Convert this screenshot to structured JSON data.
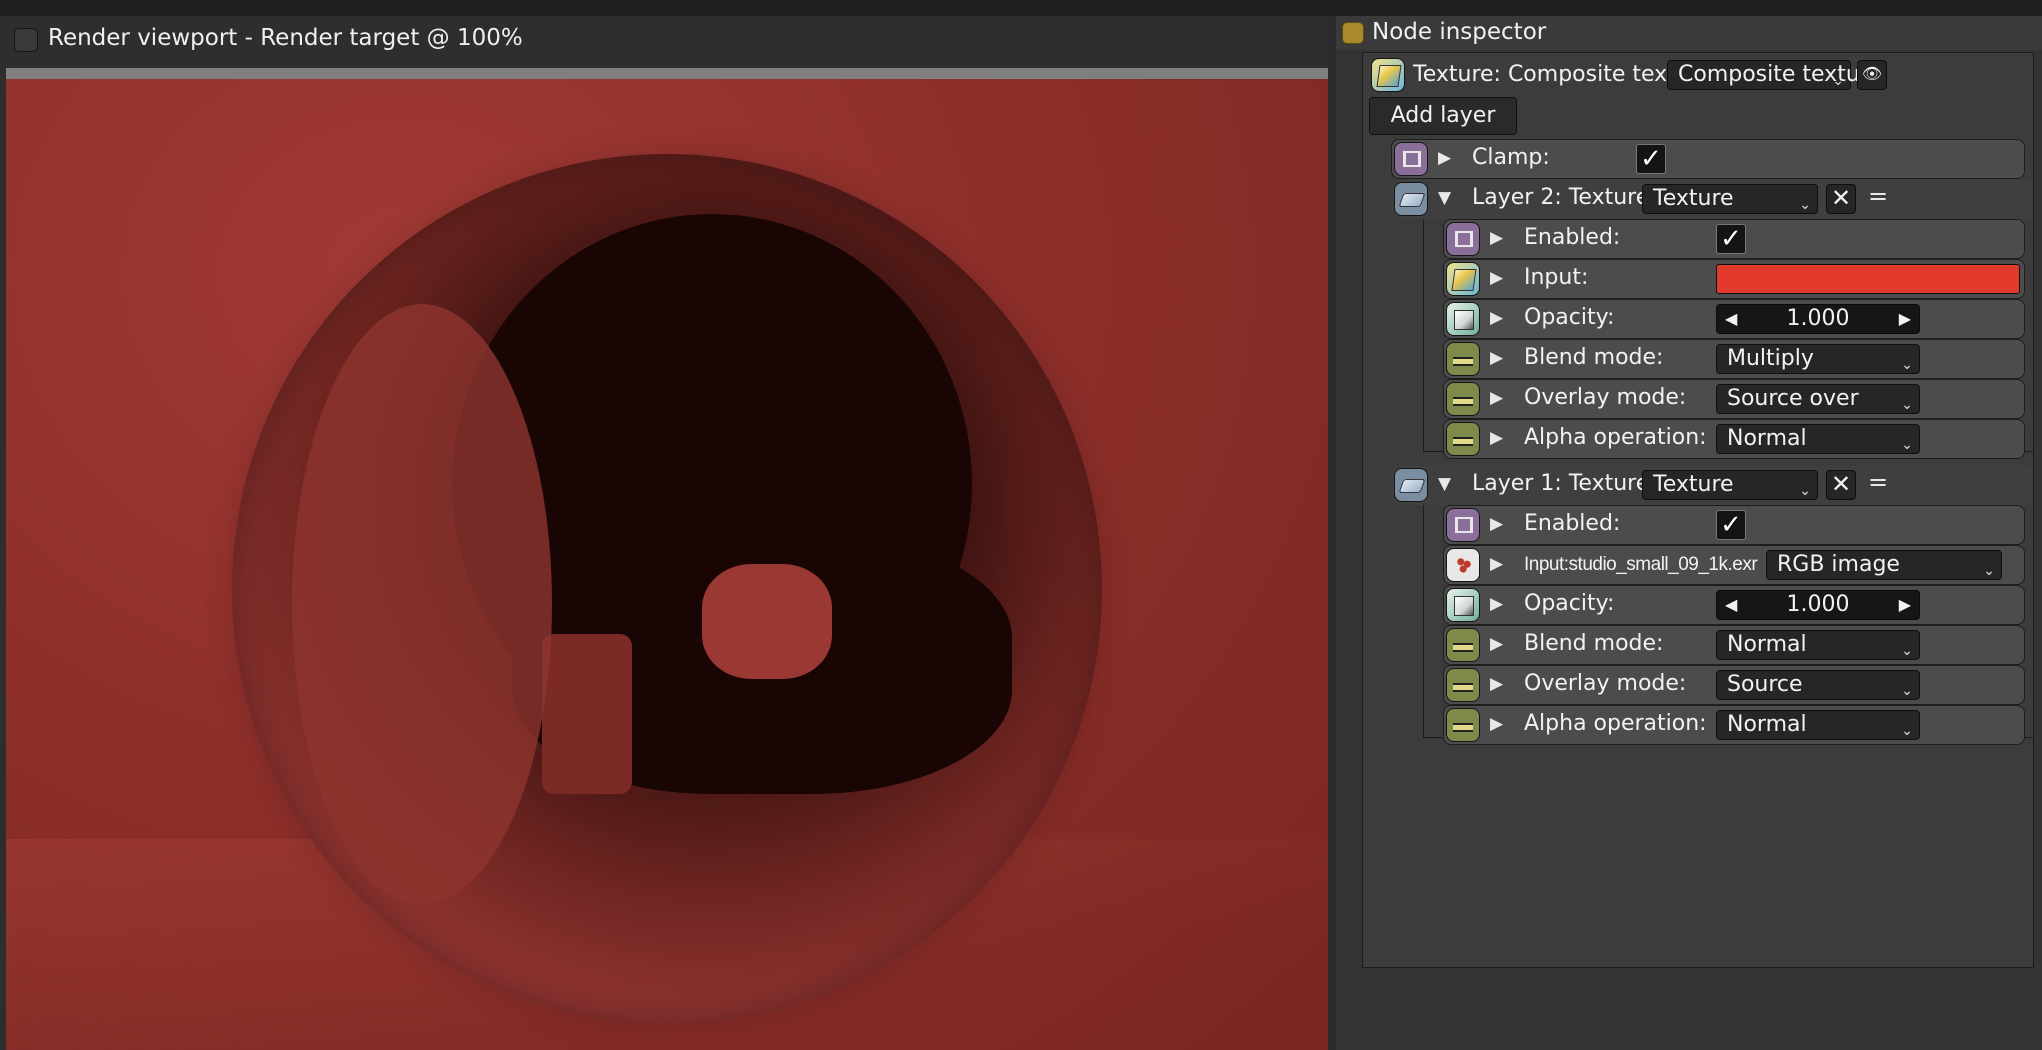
{
  "viewport": {
    "title": "Render viewport - Render target @ 100%"
  },
  "inspector": {
    "title": "Node inspector",
    "node": {
      "label": "Texture: Composite texture",
      "type_value": "Composite texture"
    },
    "add_layer_label": "Add layer",
    "clamp": {
      "label": "Clamp:",
      "checked": true
    },
    "layers": [
      {
        "title": "Layer 2: Texture",
        "type_value": "Texture",
        "rows": {
          "enabled_label": "Enabled:",
          "input_label": "Input:",
          "input_color": "#e23a2a",
          "opacity_label": "Opacity:",
          "opacity_value": "1.000",
          "blend_label": "Blend mode:",
          "blend_value": "Multiply",
          "overlay_label": "Overlay mode:",
          "overlay_value": "Source over",
          "alpha_label": "Alpha operation:",
          "alpha_value": "Normal"
        }
      },
      {
        "title": "Layer 1: Texture",
        "type_value": "Texture",
        "rows": {
          "enabled_label": "Enabled:",
          "input_label": "Input:studio_small_09_1k.exr",
          "input_value": "RGB image",
          "opacity_label": "Opacity:",
          "opacity_value": "1.000",
          "blend_label": "Blend mode:",
          "blend_value": "Normal",
          "overlay_label": "Overlay mode:",
          "overlay_value": "Source",
          "alpha_label": "Alpha operation:",
          "alpha_value": "Normal"
        }
      }
    ],
    "symbols": {
      "check": "✓",
      "expand": "▶",
      "collapse": "▼",
      "close": "✕",
      "handle": "=",
      "left": "◀",
      "right": "▶",
      "caret": "⌄"
    }
  }
}
